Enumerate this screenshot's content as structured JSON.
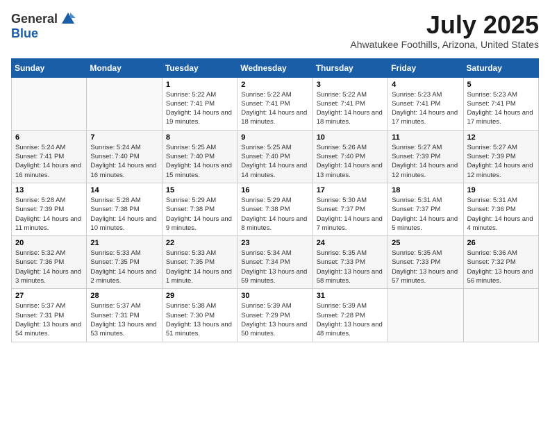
{
  "header": {
    "logo_general": "General",
    "logo_blue": "Blue",
    "month": "July 2025",
    "location": "Ahwatukee Foothills, Arizona, United States"
  },
  "weekdays": [
    "Sunday",
    "Monday",
    "Tuesday",
    "Wednesday",
    "Thursday",
    "Friday",
    "Saturday"
  ],
  "weeks": [
    [
      {
        "day": "",
        "sunrise": "",
        "sunset": "",
        "daylight": ""
      },
      {
        "day": "",
        "sunrise": "",
        "sunset": "",
        "daylight": ""
      },
      {
        "day": "1",
        "sunrise": "Sunrise: 5:22 AM",
        "sunset": "Sunset: 7:41 PM",
        "daylight": "Daylight: 14 hours and 19 minutes."
      },
      {
        "day": "2",
        "sunrise": "Sunrise: 5:22 AM",
        "sunset": "Sunset: 7:41 PM",
        "daylight": "Daylight: 14 hours and 18 minutes."
      },
      {
        "day": "3",
        "sunrise": "Sunrise: 5:22 AM",
        "sunset": "Sunset: 7:41 PM",
        "daylight": "Daylight: 14 hours and 18 minutes."
      },
      {
        "day": "4",
        "sunrise": "Sunrise: 5:23 AM",
        "sunset": "Sunset: 7:41 PM",
        "daylight": "Daylight: 14 hours and 17 minutes."
      },
      {
        "day": "5",
        "sunrise": "Sunrise: 5:23 AM",
        "sunset": "Sunset: 7:41 PM",
        "daylight": "Daylight: 14 hours and 17 minutes."
      }
    ],
    [
      {
        "day": "6",
        "sunrise": "Sunrise: 5:24 AM",
        "sunset": "Sunset: 7:41 PM",
        "daylight": "Daylight: 14 hours and 16 minutes."
      },
      {
        "day": "7",
        "sunrise": "Sunrise: 5:24 AM",
        "sunset": "Sunset: 7:40 PM",
        "daylight": "Daylight: 14 hours and 16 minutes."
      },
      {
        "day": "8",
        "sunrise": "Sunrise: 5:25 AM",
        "sunset": "Sunset: 7:40 PM",
        "daylight": "Daylight: 14 hours and 15 minutes."
      },
      {
        "day": "9",
        "sunrise": "Sunrise: 5:25 AM",
        "sunset": "Sunset: 7:40 PM",
        "daylight": "Daylight: 14 hours and 14 minutes."
      },
      {
        "day": "10",
        "sunrise": "Sunrise: 5:26 AM",
        "sunset": "Sunset: 7:40 PM",
        "daylight": "Daylight: 14 hours and 13 minutes."
      },
      {
        "day": "11",
        "sunrise": "Sunrise: 5:27 AM",
        "sunset": "Sunset: 7:39 PM",
        "daylight": "Daylight: 14 hours and 12 minutes."
      },
      {
        "day": "12",
        "sunrise": "Sunrise: 5:27 AM",
        "sunset": "Sunset: 7:39 PM",
        "daylight": "Daylight: 14 hours and 12 minutes."
      }
    ],
    [
      {
        "day": "13",
        "sunrise": "Sunrise: 5:28 AM",
        "sunset": "Sunset: 7:39 PM",
        "daylight": "Daylight: 14 hours and 11 minutes."
      },
      {
        "day": "14",
        "sunrise": "Sunrise: 5:28 AM",
        "sunset": "Sunset: 7:38 PM",
        "daylight": "Daylight: 14 hours and 10 minutes."
      },
      {
        "day": "15",
        "sunrise": "Sunrise: 5:29 AM",
        "sunset": "Sunset: 7:38 PM",
        "daylight": "Daylight: 14 hours and 9 minutes."
      },
      {
        "day": "16",
        "sunrise": "Sunrise: 5:29 AM",
        "sunset": "Sunset: 7:38 PM",
        "daylight": "Daylight: 14 hours and 8 minutes."
      },
      {
        "day": "17",
        "sunrise": "Sunrise: 5:30 AM",
        "sunset": "Sunset: 7:37 PM",
        "daylight": "Daylight: 14 hours and 7 minutes."
      },
      {
        "day": "18",
        "sunrise": "Sunrise: 5:31 AM",
        "sunset": "Sunset: 7:37 PM",
        "daylight": "Daylight: 14 hours and 5 minutes."
      },
      {
        "day": "19",
        "sunrise": "Sunrise: 5:31 AM",
        "sunset": "Sunset: 7:36 PM",
        "daylight": "Daylight: 14 hours and 4 minutes."
      }
    ],
    [
      {
        "day": "20",
        "sunrise": "Sunrise: 5:32 AM",
        "sunset": "Sunset: 7:36 PM",
        "daylight": "Daylight: 14 hours and 3 minutes."
      },
      {
        "day": "21",
        "sunrise": "Sunrise: 5:33 AM",
        "sunset": "Sunset: 7:35 PM",
        "daylight": "Daylight: 14 hours and 2 minutes."
      },
      {
        "day": "22",
        "sunrise": "Sunrise: 5:33 AM",
        "sunset": "Sunset: 7:35 PM",
        "daylight": "Daylight: 14 hours and 1 minute."
      },
      {
        "day": "23",
        "sunrise": "Sunrise: 5:34 AM",
        "sunset": "Sunset: 7:34 PM",
        "daylight": "Daylight: 13 hours and 59 minutes."
      },
      {
        "day": "24",
        "sunrise": "Sunrise: 5:35 AM",
        "sunset": "Sunset: 7:33 PM",
        "daylight": "Daylight: 13 hours and 58 minutes."
      },
      {
        "day": "25",
        "sunrise": "Sunrise: 5:35 AM",
        "sunset": "Sunset: 7:33 PM",
        "daylight": "Daylight: 13 hours and 57 minutes."
      },
      {
        "day": "26",
        "sunrise": "Sunrise: 5:36 AM",
        "sunset": "Sunset: 7:32 PM",
        "daylight": "Daylight: 13 hours and 56 minutes."
      }
    ],
    [
      {
        "day": "27",
        "sunrise": "Sunrise: 5:37 AM",
        "sunset": "Sunset: 7:31 PM",
        "daylight": "Daylight: 13 hours and 54 minutes."
      },
      {
        "day": "28",
        "sunrise": "Sunrise: 5:37 AM",
        "sunset": "Sunset: 7:31 PM",
        "daylight": "Daylight: 13 hours and 53 minutes."
      },
      {
        "day": "29",
        "sunrise": "Sunrise: 5:38 AM",
        "sunset": "Sunset: 7:30 PM",
        "daylight": "Daylight: 13 hours and 51 minutes."
      },
      {
        "day": "30",
        "sunrise": "Sunrise: 5:39 AM",
        "sunset": "Sunset: 7:29 PM",
        "daylight": "Daylight: 13 hours and 50 minutes."
      },
      {
        "day": "31",
        "sunrise": "Sunrise: 5:39 AM",
        "sunset": "Sunset: 7:28 PM",
        "daylight": "Daylight: 13 hours and 48 minutes."
      },
      {
        "day": "",
        "sunrise": "",
        "sunset": "",
        "daylight": ""
      },
      {
        "day": "",
        "sunrise": "",
        "sunset": "",
        "daylight": ""
      }
    ]
  ]
}
